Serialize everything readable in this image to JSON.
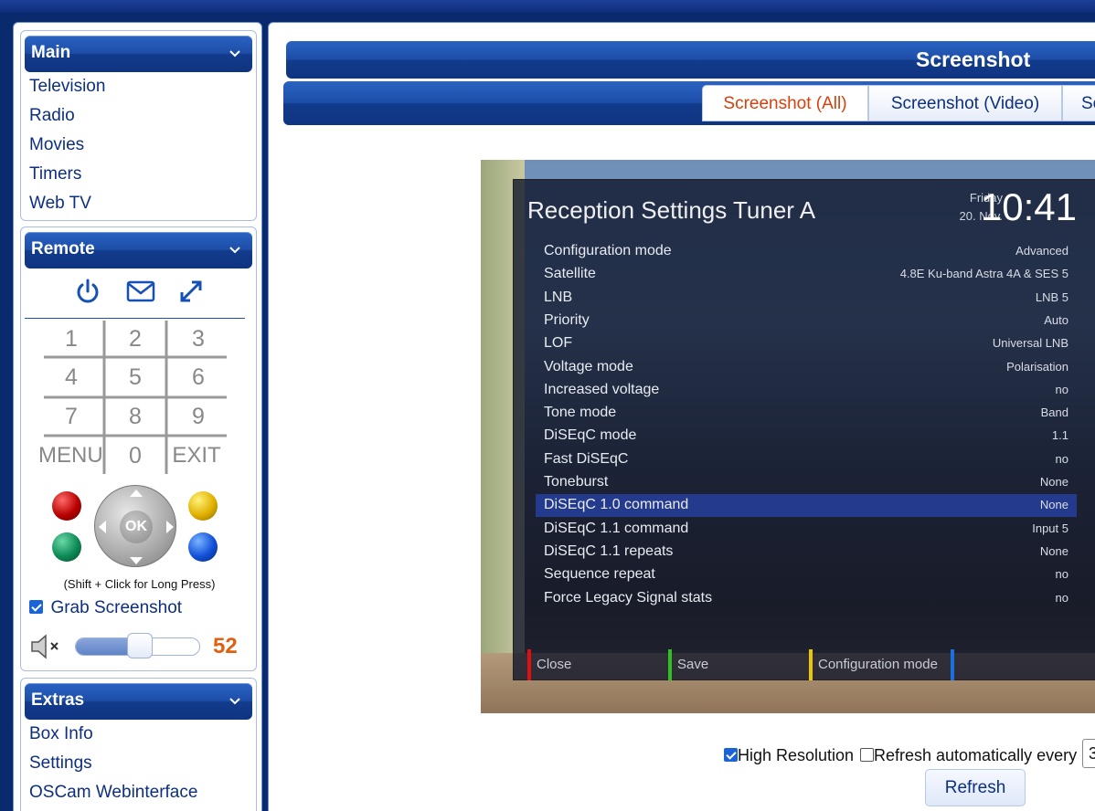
{
  "sidebar": {
    "main": {
      "title": "Main",
      "items": [
        "Television",
        "Radio",
        "Movies",
        "Timers",
        "Web TV"
      ]
    },
    "remote": {
      "title": "Remote",
      "keys": [
        "1",
        "2",
        "3",
        "4",
        "5",
        "6",
        "7",
        "8",
        "9",
        "MENU",
        "0",
        "EXIT"
      ],
      "ok_label": "OK",
      "long_press_hint": "(Shift + Click for Long Press)",
      "grab_label": "Grab Screenshot",
      "grab_checked": true,
      "volume": 52,
      "volume_display": "52"
    },
    "extras": {
      "title": "Extras",
      "items": [
        "Box Info",
        "Settings",
        "OSCam Webinterface"
      ]
    }
  },
  "main": {
    "title": "Screenshot",
    "tabs": [
      "Screenshot (All)",
      "Screenshot (Video)",
      "Sc"
    ],
    "active_tab": 0
  },
  "tv_osd": {
    "title": "Reception Settings Tuner A",
    "day": "Friday",
    "date": "20. Nov.",
    "time": "10:41",
    "rows": [
      {
        "label": "Configuration mode",
        "value": "Advanced"
      },
      {
        "label": "Satellite",
        "value": "4.8E Ku-band Astra 4A & SES 5"
      },
      {
        "label": "LNB",
        "value": "LNB 5"
      },
      {
        "label": "Priority",
        "value": "Auto"
      },
      {
        "label": "LOF",
        "value": "Universal LNB"
      },
      {
        "label": "Voltage mode",
        "value": "Polarisation"
      },
      {
        "label": "Increased voltage",
        "value": "no"
      },
      {
        "label": "Tone mode",
        "value": "Band"
      },
      {
        "label": "DiSEqC mode",
        "value": "1.1"
      },
      {
        "label": "Fast DiSEqC",
        "value": "no"
      },
      {
        "label": "Toneburst",
        "value": "None"
      },
      {
        "label": "DiSEqC 1.0 command",
        "value": "None"
      },
      {
        "label": "DiSEqC 1.1 command",
        "value": "Input 5"
      },
      {
        "label": "DiSEqC 1.1 repeats",
        "value": "None"
      },
      {
        "label": "Sequence repeat",
        "value": "no"
      },
      {
        "label": "Force Legacy Signal stats",
        "value": "no"
      }
    ],
    "selected_row": 11,
    "keys": [
      {
        "label": "Close",
        "color": "#e01010"
      },
      {
        "label": "Save",
        "color": "#30c020"
      },
      {
        "label": "Configuration mode",
        "color": "#e8c800"
      },
      {
        "label": "",
        "color": "#1a70e0"
      }
    ]
  },
  "controls": {
    "high_res_label": "High Resolution",
    "high_res_checked": true,
    "auto_refresh_label": "Refresh automatically every",
    "auto_refresh_checked": false,
    "interval_value": "3",
    "refresh_button": "Refresh"
  },
  "colors": {
    "accent_blue": "#1d4ea8",
    "link_blue": "#0d2f80",
    "active_tab": "#d83f0a",
    "volume_number": "#e06010"
  }
}
